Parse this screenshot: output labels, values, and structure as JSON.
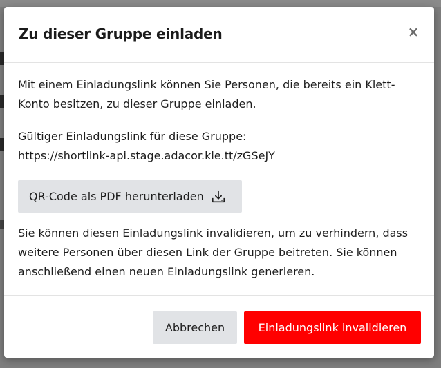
{
  "modal": {
    "title": "Zu dieser Gruppe einladen",
    "close_label": "×",
    "intro_lines": [
      "Mit einem Einladungslink können Sie Personen, die bereits ein Klett-",
      "Konto besitzen, zu dieser Gruppe einladen."
    ],
    "link_label": "Gültiger Einladungslink für diese Gruppe:",
    "link_url": "https://shortlink-api.stage.adacor.kle.tt/zGSeJY",
    "qr_button_label": "QR-Code als PDF herunterladen",
    "qr_button_icon": "download-icon",
    "info_lines": [
      "Sie können diesen Einladungslink invalidieren, um zu verhindern, dass",
      "weitere Personen über diesen Link der Gruppe beitreten. Sie können",
      "anschließend einen neuen Einladungslink generieren."
    ],
    "cancel_label": "Abbrechen",
    "invalidate_label": "Einladungslink invalidieren"
  },
  "colors": {
    "danger": "#ff0000",
    "secondary_button": "#e1e3e6",
    "overlay": "#7e7e7e",
    "text": "#1d1d1d"
  }
}
